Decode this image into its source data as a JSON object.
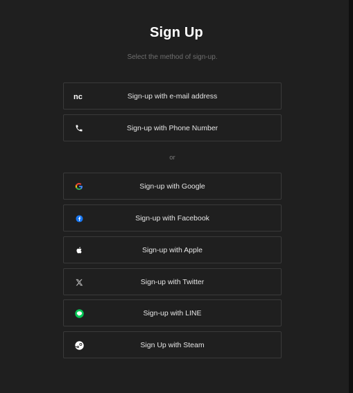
{
  "header": {
    "title": "Sign Up",
    "subtitle": "Select the method of sign-up."
  },
  "primary_options": [
    {
      "label": "Sign-up with e-mail address",
      "icon": "nc-logo-icon"
    },
    {
      "label": "Sign-up with Phone Number",
      "icon": "phone-icon"
    }
  ],
  "divider": {
    "label": "or"
  },
  "social_options": [
    {
      "label": "Sign-up with Google",
      "icon": "google-icon"
    },
    {
      "label": "Sign-up with Facebook",
      "icon": "facebook-icon"
    },
    {
      "label": "Sign-up with Apple",
      "icon": "apple-icon"
    },
    {
      "label": "Sign-up with Twitter",
      "icon": "x-twitter-icon"
    },
    {
      "label": "Sign-up with LINE",
      "icon": "line-icon"
    },
    {
      "label": "Sign Up with Steam",
      "icon": "steam-icon"
    }
  ],
  "colors": {
    "background": "#1f1f1f",
    "border": "#3a3a3a",
    "google_blue": "#4285f4",
    "facebook_blue": "#1877f2",
    "line_green": "#06c755"
  }
}
